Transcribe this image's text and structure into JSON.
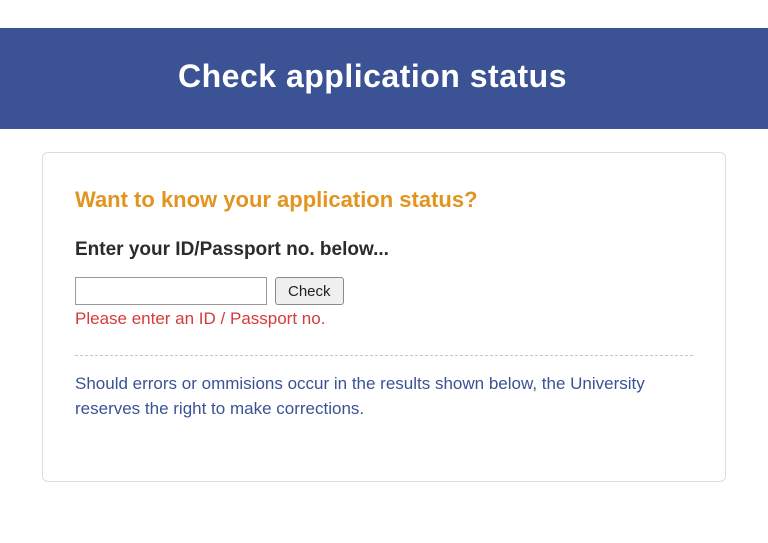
{
  "header": {
    "title": "Check application status"
  },
  "card": {
    "subtitle": "Want to know your application status?",
    "instruction": "Enter your ID/Passport no. below...",
    "input_value": "",
    "check_label": "Check",
    "error": "Please enter an ID / Passport no.",
    "disclaimer": "Should errors or ommisions occur in the results shown below, the University reserves the right to make corrections."
  }
}
